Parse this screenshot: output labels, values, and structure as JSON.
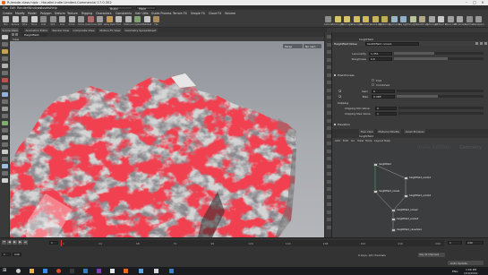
{
  "window": {
    "title": "R:/erode class.hiplc - Houdini Indie Limited-Commercial 17.0.352",
    "controls": [
      "–",
      "□",
      "×"
    ]
  },
  "menubar": {
    "items": [
      "File",
      "Edit",
      "Render",
      "Windows",
      "Assets",
      "Help"
    ],
    "desktop": "Build",
    "main": "Main"
  },
  "shelf": {
    "tabs": [
      "Create",
      "Modify",
      "Model",
      "Polygon",
      "Deform",
      "Texture",
      "Rigging",
      "Characters",
      "Constraints",
      "Hair Utils",
      "Guide Process",
      "Terrain FX",
      "Simple FX",
      "Cloud FX",
      "Volume"
    ],
    "tools": [
      {
        "label": "Box",
        "color": "#b9b9b9"
      },
      {
        "label": "Sphere",
        "color": "#c8c8c8"
      },
      {
        "label": "Tube",
        "color": "#a9a9a9"
      },
      {
        "label": "Torus",
        "color": "#cfcfcf"
      },
      {
        "label": "Grid",
        "color": "#8a8a8a"
      },
      {
        "label": "Null",
        "color": "#909090"
      },
      {
        "label": "Line",
        "color": "#a5a5a5"
      },
      {
        "label": "Circle",
        "color": "#b0b0b0"
      },
      {
        "label": "Curve",
        "color": "#9a9a9a"
      },
      {
        "label": "Draw Curve",
        "color": "#b06a6a"
      },
      {
        "label": "Path",
        "color": "#a0a0a0"
      },
      {
        "label": "Spray Paint",
        "color": "#c49a5c"
      },
      {
        "label": "Font",
        "color": "#bdbdbd"
      },
      {
        "label": "Platonic",
        "color": "#b5b5b5"
      },
      {
        "label": "L-System",
        "color": "#7ea36f"
      },
      {
        "label": "Metaball",
        "color": "#c7c7c7"
      },
      {
        "label": "File",
        "color": "#a88c5c"
      }
    ],
    "right_tools": [
      {
        "label": "Camera",
        "color": "#8c8c8c"
      },
      {
        "label": "Point Light",
        "color": "#d9c46a"
      },
      {
        "label": "Spot Light",
        "color": "#d5c26b"
      },
      {
        "label": "Area Light",
        "color": "#d3bf62"
      },
      {
        "label": "Geometry Light",
        "color": "#cfb85e"
      },
      {
        "label": "Volume Light",
        "color": "#c7b35c"
      },
      {
        "label": "Distant Light",
        "color": "#c0ad57"
      },
      {
        "label": "Environment Light",
        "color": "#9ab6c9"
      },
      {
        "label": "Sky Light",
        "color": "#8fb0c8"
      },
      {
        "label": "GI Light",
        "color": "#b7c29a"
      },
      {
        "label": "Caustic Light",
        "color": "#b1a888"
      },
      {
        "label": "Portal Light",
        "color": "#a3a3a3"
      },
      {
        "label": "Ambient Light",
        "color": "#c9c9c9"
      },
      {
        "label": "Stereo Camera",
        "color": "#9e9e9e"
      },
      {
        "label": "VR Camera",
        "color": "#a6a6a6"
      },
      {
        "label": "Switcher",
        "color": "#8d8d8d"
      },
      {
        "label": "Gamepad Camera",
        "color": "#999999"
      }
    ]
  },
  "panes": {
    "left_tabs": [
      "Scene View",
      "Animation Editor",
      "Render View",
      "Composite View",
      "Motion FX View",
      "Geometry Spreadsheet"
    ],
    "viewport_header": "Heightfield",
    "view_label": "View",
    "persp_label": "Persp",
    "cam_label": "No cam"
  },
  "params": {
    "node_type": "Heightfield Noise",
    "node_name": "heightfield_noise1",
    "path": "heightfield",
    "rows": [
      {
        "label": "Lacunarity",
        "value": "1.351",
        "fill": 0.45
      },
      {
        "label": "Roughness",
        "value": "0.6",
        "fill": 0.6
      }
    ],
    "post_process": "Post-Process",
    "fold": "Fold",
    "combined": "Combined",
    "gain_label": "Gain",
    "gain_value": "0",
    "bias_label": "Bias",
    "bias_value": "0.468",
    "clipping": "Clipping",
    "clip_min_label": "Clipping Min Value",
    "clip_min": "0",
    "clip_max_label": "Clipping Max Value",
    "clip_max": "1",
    "elevation": "Elevation"
  },
  "network": {
    "tabs": [
      "Tree View",
      "Material Palette",
      "Asset Browser"
    ],
    "path": "heightfield",
    "menu": [
      "Add",
      "Edit",
      "Go",
      "View",
      "Tools",
      "Layout",
      "Help"
    ],
    "watermark": "Indie Edition",
    "context_label": "Geometry",
    "nodes": [
      {
        "name": "heightfield",
        "color": "#c4c4c4"
      },
      {
        "name": "heightfield_noise1",
        "color": "#d0d0d0"
      },
      {
        "name": "heightfield_erode1",
        "color": "#c8c8c8"
      },
      {
        "name": "heightfield_erode2",
        "color": "#c8c8c8"
      },
      {
        "name": "heightfield_noise2",
        "color": "#bcbcbc"
      },
      {
        "name": "heightfield_erode3",
        "color": "#c6c6c6"
      },
      {
        "name": "heightfield_visualize1",
        "color": "#b8b8b8"
      }
    ]
  },
  "timeline": {
    "frame": "1",
    "start": "1",
    "end": "240",
    "ticks": [
      "1",
      "24",
      "48",
      "72",
      "96",
      "120",
      "144",
      "168",
      "192",
      "216",
      "240"
    ],
    "range_start": "1",
    "range_end": "240",
    "auto_update": "Auto Update",
    "keys_label": "0 keys, 0/0 channels",
    "key_all": "Key All Channels"
  },
  "taskbar": {
    "time": "1:06 PM",
    "date": "2/16/2019",
    "lang": "ENG"
  }
}
